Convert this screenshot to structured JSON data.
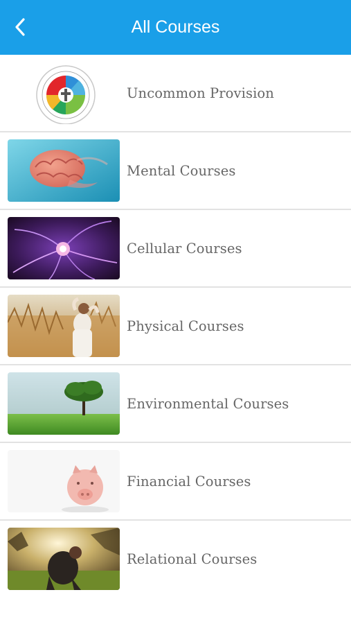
{
  "header": {
    "title": "All Courses",
    "back_icon": "chevron-left-icon",
    "bg_color": "#1a9fe8"
  },
  "courses": [
    {
      "label": "Uncommon Provision",
      "image": "eternal-wellness-logo"
    },
    {
      "label": "Mental Courses",
      "image": "brain-photo"
    },
    {
      "label": "Cellular Courses",
      "image": "plasma-ball-photo"
    },
    {
      "label": "Physical Courses",
      "image": "stretching-woman-photo"
    },
    {
      "label": "Environmental Courses",
      "image": "tree-field-photo"
    },
    {
      "label": "Financial Courses",
      "image": "piggy-bank-photo"
    },
    {
      "label": "Relational Courses",
      "image": "parent-child-sunset-photo"
    }
  ]
}
